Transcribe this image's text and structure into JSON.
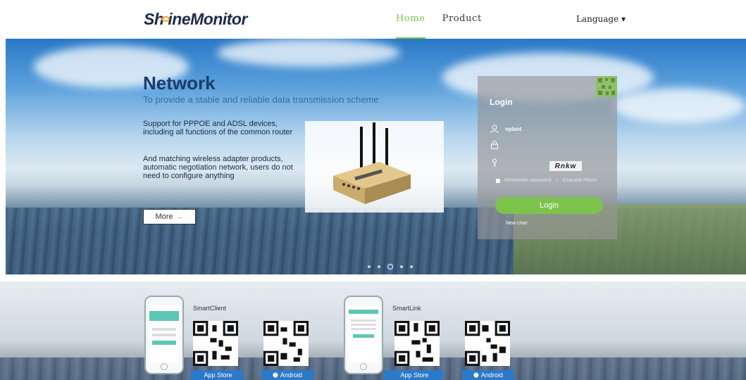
{
  "header": {
    "logo_shine": "Sh",
    "logo_ine": "ine",
    "logo_monitor": "Monitor",
    "nav": [
      {
        "label": "Home",
        "active": true
      },
      {
        "label": "Product",
        "active": false
      }
    ],
    "language": "Language ▾"
  },
  "banner": {
    "title": "Network",
    "subtitle": "To provide a stable and reliable data transmission scheme",
    "paragraph1": "Support for PPPOE and ADSL devices, including all functions of the common router",
    "paragraph2": "And matching wireless adapter products, automatic negotiation network, users do not need to configure anything",
    "more_label": "More",
    "dots_count": 5,
    "active_dot": 2
  },
  "login": {
    "title": "Login",
    "username_value": "vplant",
    "captcha": "Rnkw",
    "captcha_status": "✔",
    "remember": "Remember password",
    "example": "Example Plants",
    "button": "Login",
    "new_user": "New User"
  },
  "apps": [
    {
      "name": "SmartClient",
      "app_store": "App Store",
      "android": "Android"
    },
    {
      "name": "SmartLink",
      "app_store": "App Store",
      "android": "Android"
    }
  ],
  "colors": {
    "accent_green": "#7cc34c",
    "store_blue": "#2b79c9",
    "title_blue": "#1b3c6e"
  }
}
